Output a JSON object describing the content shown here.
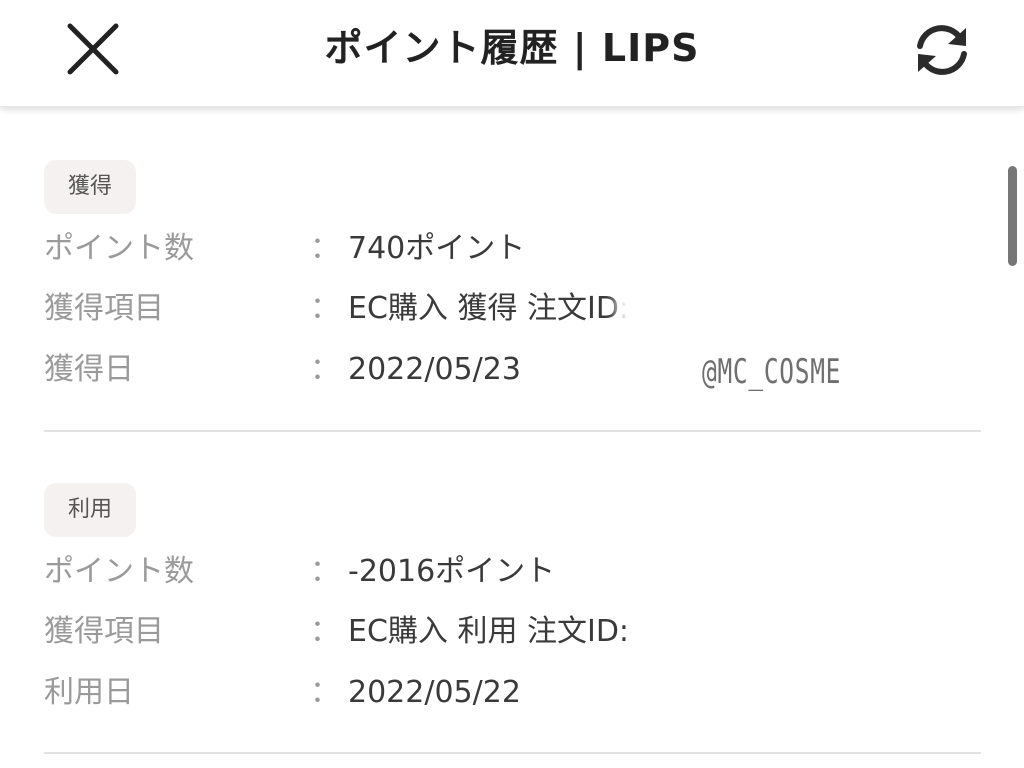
{
  "header": {
    "title": "ポイント履歴 | LIPS",
    "close_icon": "close-icon",
    "reload_icon": "reload-icon"
  },
  "records": [
    {
      "badge": "獲得",
      "rows": [
        {
          "label": "ポイント数",
          "colon": "：",
          "value": "740ポイント"
        },
        {
          "label": "獲得項目",
          "colon": "：",
          "value": "EC購入 獲得 注文ID:"
        },
        {
          "label": "獲得日",
          "colon": "：",
          "value": "2022/05/23"
        }
      ]
    },
    {
      "badge": "利用",
      "rows": [
        {
          "label": "ポイント数",
          "colon": "：",
          "value": "-2016ポイント"
        },
        {
          "label": "獲得項目",
          "colon": "：",
          "value": "EC購入 利用 注文ID:"
        },
        {
          "label": "利用日",
          "colon": "：",
          "value": "2022/05/22"
        }
      ]
    }
  ],
  "watermark": "@MC_COSME",
  "colors": {
    "text_primary": "#3a3a3a",
    "text_label": "#9a9a9a",
    "badge_bg": "#f6f1f1",
    "divider": "#e2e2e2"
  }
}
